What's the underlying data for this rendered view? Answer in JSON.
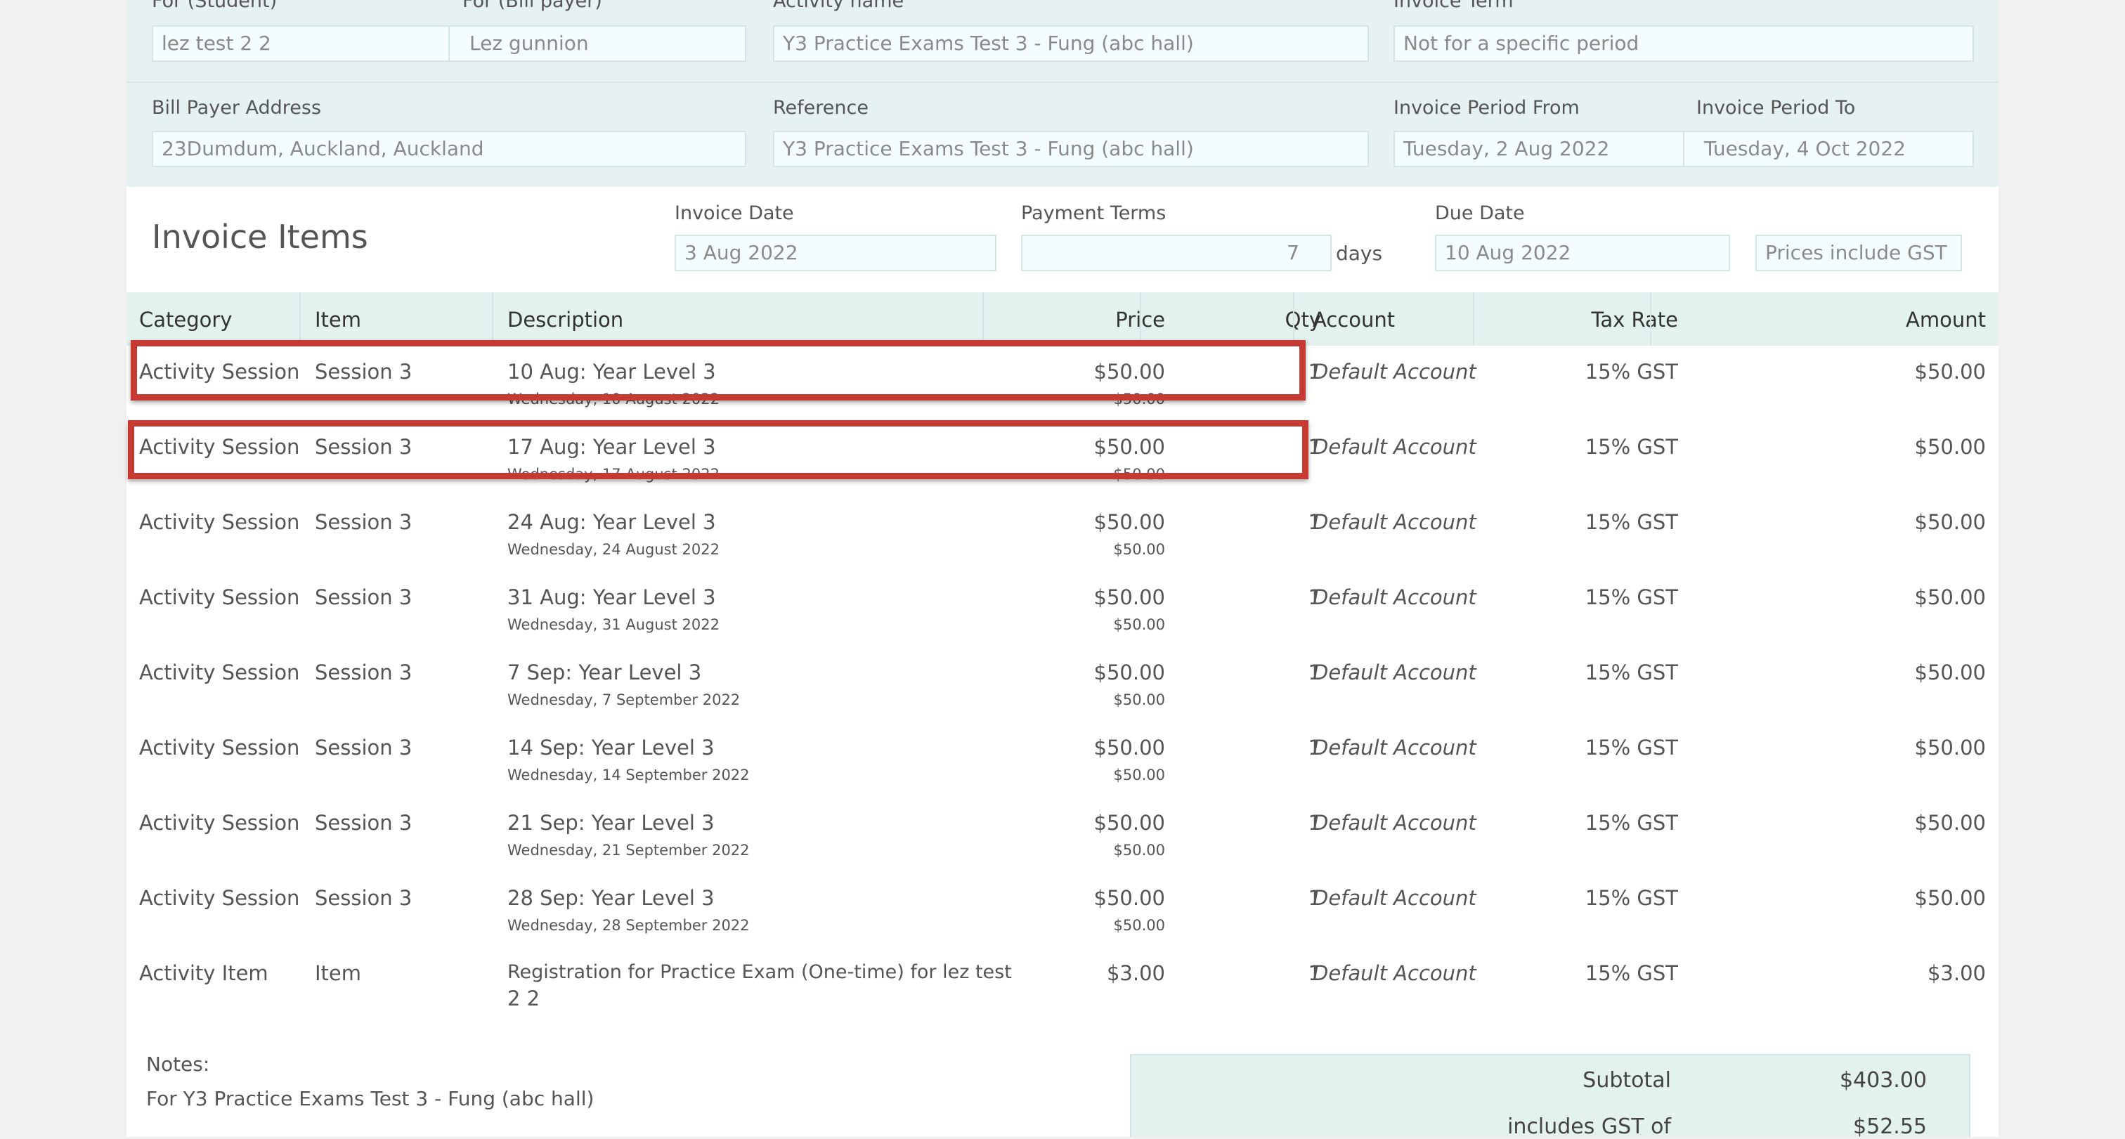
{
  "header": {
    "for_student_label": "For (Student)",
    "for_student_value": "lez test 2 2",
    "for_bill_payer_label": "For (Bill payer)",
    "for_bill_payer_value": "Lez gunnion",
    "activity_name_label": "Activity name",
    "activity_name_value": "Y3 Practice Exams Test 3 - Fung (abc hall)",
    "invoice_term_label": "Invoice Term",
    "invoice_term_value": "Not for a specific period",
    "bill_payer_address_label": "Bill Payer Address",
    "bill_payer_address_value": "23Dumdum, Auckland, Auckland",
    "reference_label": "Reference",
    "reference_value": "Y3 Practice Exams Test 3 - Fung (abc hall)",
    "period_from_label": "Invoice Period From",
    "period_from_value": "Tuesday, 2 Aug 2022",
    "period_to_label": "Invoice Period To",
    "period_to_value": "Tuesday, 4 Oct 2022"
  },
  "invoice": {
    "title": "Invoice Items",
    "invoice_date_label": "Invoice Date",
    "invoice_date_value": "3 Aug 2022",
    "payment_terms_label": "Payment Terms",
    "payment_terms_value": "7",
    "payment_terms_unit": "days",
    "due_date_label": "Due Date",
    "due_date_value": "10 Aug 2022",
    "gst_mode": "Prices include GST"
  },
  "table": {
    "columns": {
      "category": "Category",
      "item": "Item",
      "description": "Description",
      "price": "Price",
      "qty": "Qty",
      "account": "Account",
      "tax_rate": "Tax Rate",
      "amount": "Amount"
    },
    "rows": [
      {
        "category": "Activity Session",
        "item": "Session 3",
        "description": "10 Aug: Year Level 3",
        "date": "Wednesday, 10 August 2022",
        "price": "$50.00",
        "sub_price": "$50.00",
        "qty": "1",
        "account": "Default Account",
        "tax_rate": "15% GST",
        "amount": "$50.00",
        "highlighted": true
      },
      {
        "category": "Activity Session",
        "item": "Session 3",
        "description": "17 Aug: Year Level 3",
        "date": "Wednesday, 17 August 2022",
        "price": "$50.00",
        "sub_price": "$50.00",
        "qty": "1",
        "account": "Default Account",
        "tax_rate": "15% GST",
        "amount": "$50.00",
        "highlighted": true
      },
      {
        "category": "Activity Session",
        "item": "Session 3",
        "description": "24 Aug: Year Level 3",
        "date": "Wednesday, 24 August 2022",
        "price": "$50.00",
        "sub_price": "$50.00",
        "qty": "1",
        "account": "Default Account",
        "tax_rate": "15% GST",
        "amount": "$50.00",
        "highlighted": false
      },
      {
        "category": "Activity Session",
        "item": "Session 3",
        "description": "31 Aug: Year Level 3",
        "date": "Wednesday, 31 August 2022",
        "price": "$50.00",
        "sub_price": "$50.00",
        "qty": "1",
        "account": "Default Account",
        "tax_rate": "15% GST",
        "amount": "$50.00",
        "highlighted": false
      },
      {
        "category": "Activity Session",
        "item": "Session 3",
        "description": "7 Sep: Year Level 3",
        "date": "Wednesday, 7 September 2022",
        "price": "$50.00",
        "sub_price": "$50.00",
        "qty": "1",
        "account": "Default Account",
        "tax_rate": "15% GST",
        "amount": "$50.00",
        "highlighted": false
      },
      {
        "category": "Activity Session",
        "item": "Session 3",
        "description": "14 Sep: Year Level 3",
        "date": "Wednesday, 14 September 2022",
        "price": "$50.00",
        "sub_price": "$50.00",
        "qty": "1",
        "account": "Default Account",
        "tax_rate": "15% GST",
        "amount": "$50.00",
        "highlighted": false
      },
      {
        "category": "Activity Session",
        "item": "Session 3",
        "description": "21 Sep: Year Level 3",
        "date": "Wednesday, 21 September 2022",
        "price": "$50.00",
        "sub_price": "$50.00",
        "qty": "1",
        "account": "Default Account",
        "tax_rate": "15% GST",
        "amount": "$50.00",
        "highlighted": false
      },
      {
        "category": "Activity Session",
        "item": "Session 3",
        "description": "28 Sep: Year Level 3",
        "date": "Wednesday, 28 September 2022",
        "price": "$50.00",
        "sub_price": "$50.00",
        "qty": "1",
        "account": "Default Account",
        "tax_rate": "15% GST",
        "amount": "$50.00",
        "highlighted": false
      },
      {
        "category": "Activity Item",
        "item": "Item",
        "description": "Registration for Practice Exam (One-time) for lez test",
        "description_cont": "2 2",
        "price": "$3.00",
        "qty": "1",
        "account": "Default Account",
        "tax_rate": "15% GST",
        "amount": "$3.00",
        "highlighted": false
      }
    ]
  },
  "notes": {
    "label": "Notes:",
    "text": "For Y3 Practice Exams Test 3 - Fung (abc hall)"
  },
  "totals": {
    "subtotal_label": "Subtotal",
    "subtotal_value": "$403.00",
    "gst_label": "includes GST of",
    "gst_value": "$52.55"
  },
  "colors": {
    "highlight": "#c63a33",
    "panel": "#e5f2f1",
    "header_row": "#e3f1ef"
  }
}
